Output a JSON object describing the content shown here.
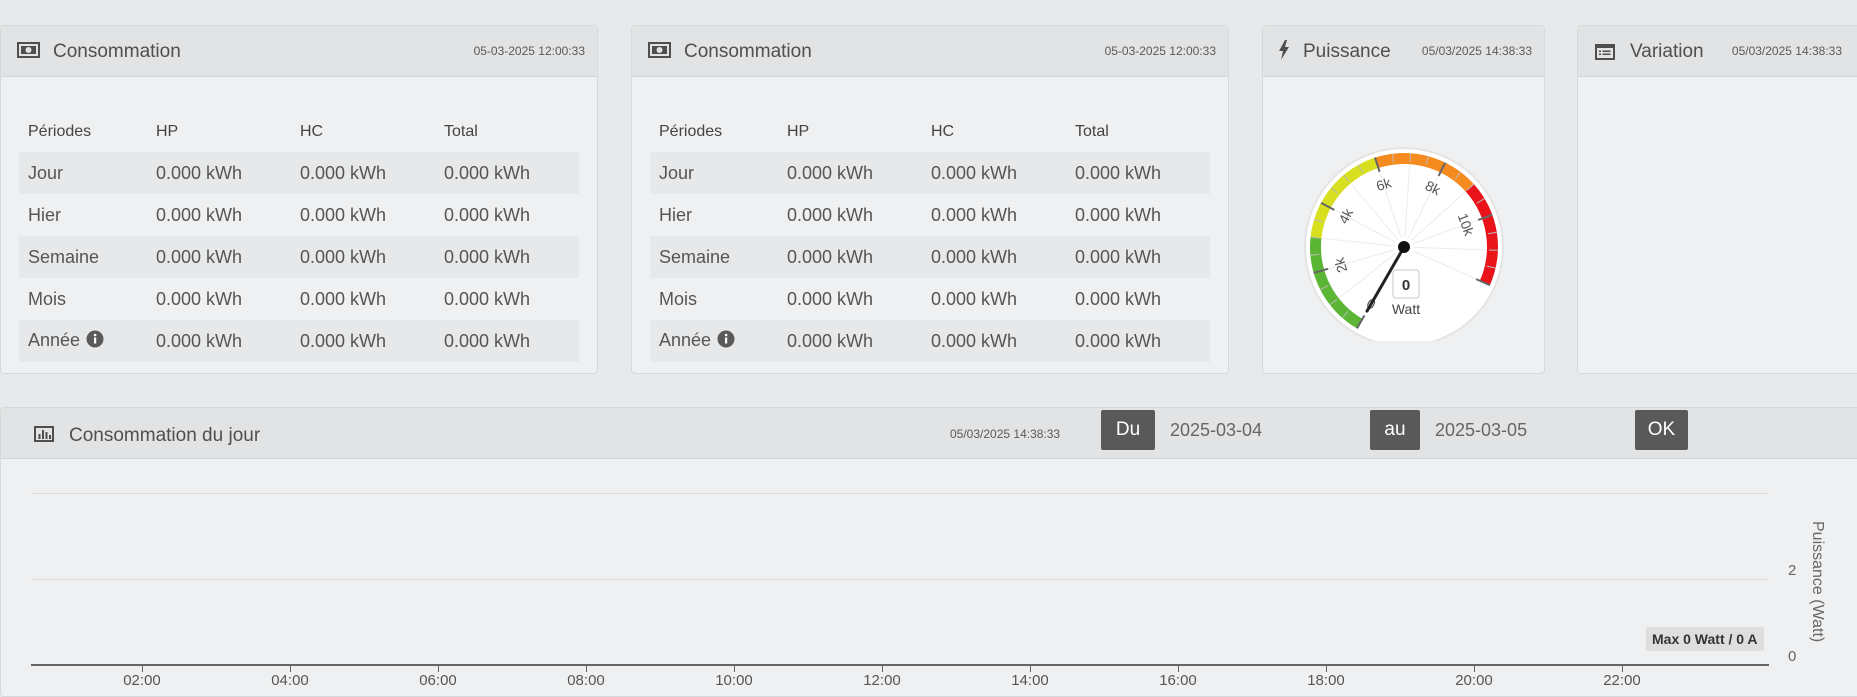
{
  "panels": {
    "conso1": {
      "title": "Consommation",
      "timestamp": "05-03-2025 12:00:33",
      "headers": [
        "Périodes",
        "HP",
        "HC",
        "Total"
      ],
      "rows": [
        {
          "label": "Jour",
          "hp": "0.000 kWh",
          "hc": "0.000 kWh",
          "total": "0.000 kWh"
        },
        {
          "label": "Hier",
          "hp": "0.000 kWh",
          "hc": "0.000 kWh",
          "total": "0.000 kWh"
        },
        {
          "label": "Semaine",
          "hp": "0.000 kWh",
          "hc": "0.000 kWh",
          "total": "0.000 kWh"
        },
        {
          "label": "Mois",
          "hp": "0.000 kWh",
          "hc": "0.000 kWh",
          "total": "0.000 kWh"
        },
        {
          "label": "Année",
          "hp": "0.000 kWh",
          "hc": "0.000 kWh",
          "total": "0.000 kWh"
        }
      ]
    },
    "conso2": {
      "title": "Consommation",
      "timestamp": "05-03-2025 12:00:33",
      "headers": [
        "Périodes",
        "HP",
        "HC",
        "Total"
      ],
      "rows": [
        {
          "label": "Jour",
          "hp": "0.000 kWh",
          "hc": "0.000 kWh",
          "total": "0.000 kWh"
        },
        {
          "label": "Hier",
          "hp": "0.000 kWh",
          "hc": "0.000 kWh",
          "total": "0.000 kWh"
        },
        {
          "label": "Semaine",
          "hp": "0.000 kWh",
          "hc": "0.000 kWh",
          "total": "0.000 kWh"
        },
        {
          "label": "Mois",
          "hp": "0.000 kWh",
          "hc": "0.000 kWh",
          "total": "0.000 kWh"
        },
        {
          "label": "Année",
          "hp": "0.000 kWh",
          "hc": "0.000 kWh",
          "total": "0.000 kWh"
        }
      ]
    },
    "puissance": {
      "title": "Puissance",
      "timestamp": "05/03/2025 14:38:33",
      "gauge": {
        "value": 0,
        "value_text": "0",
        "unit": "Watt",
        "min": 0,
        "max": 12000,
        "tick_labels": [
          "0",
          "2k",
          "4k",
          "6k",
          "8k",
          "10k"
        ],
        "bands": [
          {
            "from": 0,
            "to": 3000,
            "color": "#5cb636"
          },
          {
            "from": 3000,
            "to": 6000,
            "color": "#d8df1f"
          },
          {
            "from": 6000,
            "to": 9000,
            "color": "#f58b1f"
          },
          {
            "from": 9000,
            "to": 12000,
            "color": "#e8141a"
          }
        ]
      }
    },
    "variation": {
      "title": "Variation",
      "timestamp": "05/03/2025 14:38:33"
    },
    "jour": {
      "title": "Consommation du jour",
      "timestamp": "05/03/2025 14:38:33",
      "du_label": "Du",
      "date_from": "2025-03-04",
      "au_label": "au",
      "date_to": "2025-03-05",
      "ok_label": "OK",
      "max_badge": "Max 0 Watt / 0 A"
    }
  },
  "chart_data": {
    "type": "line",
    "title": "",
    "ylabel": "Puissance (Watt)",
    "yticks": [
      "2",
      "0"
    ],
    "x_ticks": [
      "02:00",
      "04:00",
      "06:00",
      "08:00",
      "10:00",
      "12:00",
      "14:00",
      "16:00",
      "18:00",
      "20:00",
      "22:00"
    ],
    "series": []
  },
  "icons": {
    "conso": "banknote-icon",
    "puissance": "lightning-icon",
    "variation": "list-window-icon",
    "jour": "bar-chart-icon",
    "info": "info-icon"
  }
}
